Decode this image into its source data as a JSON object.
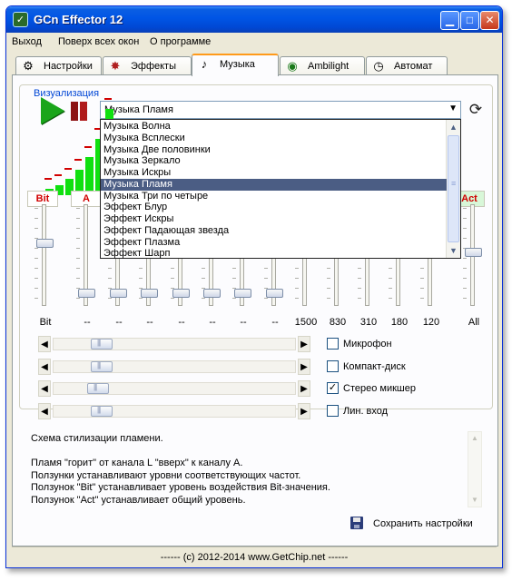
{
  "window": {
    "title": "GCn Effector 12"
  },
  "menu": [
    "Выход",
    "Поверх всех окон",
    "О программе"
  ],
  "tabs": [
    {
      "label": "Настройки",
      "icon": "gear-icon"
    },
    {
      "label": "Эффекты",
      "icon": "sparkle-icon"
    },
    {
      "label": "Музыка",
      "icon": "music-note-icon",
      "active": true
    },
    {
      "label": "Ambilight",
      "icon": "eye-icon"
    },
    {
      "label": "Автомат",
      "icon": "clock-icon"
    }
  ],
  "visualization": {
    "group_title": "Визуализация",
    "selected": "Музыка Пламя",
    "options": [
      "Музыка Волна",
      "Музыка Всплески",
      "Музыка Две половинки",
      "Музыка Зеркало",
      "Музыка Искры",
      "Музыка Пламя",
      "Музыка Три по четыре",
      "Эффект Блур",
      "Эффект Искры",
      "Эффект Падающая звезда",
      "Эффект Плазма",
      "Эффект Шарп"
    ],
    "selected_index": 5
  },
  "spectrum_levels": [
    0.06,
    0.1,
    0.16,
    0.25,
    0.38,
    0.56,
    0.86,
    0.55
  ],
  "box_labels": {
    "bit": "Bit",
    "a": "A",
    "act": "Act"
  },
  "sliders": [
    {
      "label": "Bit",
      "level": 0.62
    },
    {
      "label": "--",
      "level": 0.07
    },
    {
      "label": "--",
      "level": 0.07
    },
    {
      "label": "--",
      "level": 0.07
    },
    {
      "label": "--",
      "level": 0.07
    },
    {
      "label": "--",
      "level": 0.07
    },
    {
      "label": "--",
      "level": 0.07
    },
    {
      "label": "--",
      "level": 0.07
    },
    {
      "label": "1500",
      "level": 0.62
    },
    {
      "label": "830",
      "level": 0.62
    },
    {
      "label": "310",
      "level": 0.62
    },
    {
      "label": "180",
      "level": 0.62
    },
    {
      "label": "120",
      "level": 0.62
    },
    {
      "label": "All",
      "level": 0.52
    }
  ],
  "inputs": [
    {
      "label": "Микрофон",
      "checked": false,
      "level": 0.17
    },
    {
      "label": "Компакт-диск",
      "checked": false,
      "level": 0.17
    },
    {
      "label": "Стерео микшер",
      "checked": true,
      "level": 0.15
    },
    {
      "label": "Лин. вход",
      "checked": false,
      "level": 0.17
    }
  ],
  "description": [
    "Схема стилизации пламени.",
    "",
    "Пламя \"горит\" от канала L \"вверх\" к каналу А.",
    "Ползунки устанавливают уровни соответствующих частот.",
    "Ползунок \"Bit\" устанавливает уровень воздействия Bit-значения.",
    "Ползунок \"Act\" устанавливает общий уровень."
  ],
  "save_label": "Сохранить настройки",
  "footer": "------  (c) 2012-2014  www.GetChip.net  ------"
}
